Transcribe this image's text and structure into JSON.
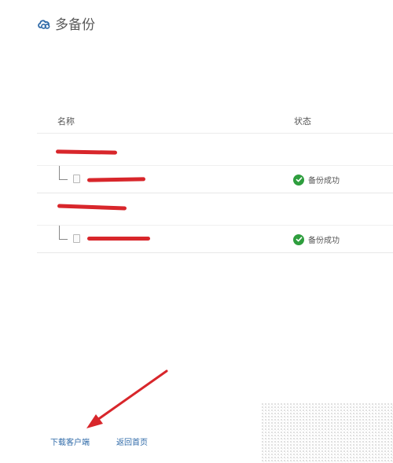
{
  "brand": {
    "name": "多备份",
    "accent": "#2f6aa8"
  },
  "table": {
    "headers": {
      "name": "名称",
      "status": "状态"
    },
    "groups": [
      {
        "name": "",
        "items": [
          {
            "name": "",
            "icon": "file-icon",
            "status": "备份成功",
            "status_icon": "check-circle-icon"
          }
        ]
      },
      {
        "name": "",
        "items": [
          {
            "name": "",
            "icon": "file-icon",
            "status": "备份成功",
            "status_icon": "check-circle-icon"
          }
        ]
      }
    ]
  },
  "footer": {
    "download_client": "下载客户端",
    "back_home": "返回首页"
  },
  "colors": {
    "success": "#2e9e3e",
    "annotation_red": "#d8262b",
    "link": "#2f6aa8"
  }
}
